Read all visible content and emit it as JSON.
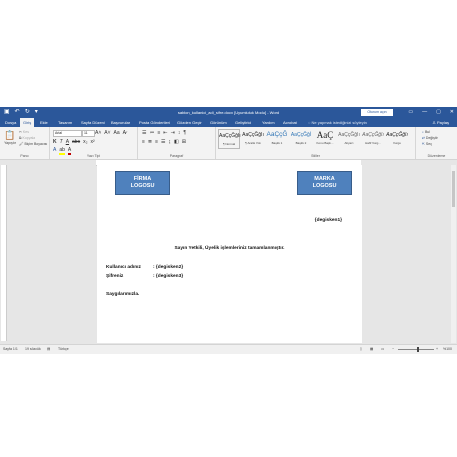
{
  "window": {
    "title": "sablon_kullanici_adi_sifre.docx [Uyumluluk Modu] - Word",
    "signin_label": "Oturum açın",
    "controls": [
      "—",
      "▢",
      "✕"
    ]
  },
  "tabs": [
    "Dosya",
    "Giriş",
    "Ekle",
    "Tasarım",
    "Sayfa Düzeni",
    "Başvurular",
    "Posta Gönderileri",
    "Gözden Geçir",
    "Görünüm",
    "Geliştirici",
    "Yardım",
    "Acrobat"
  ],
  "active_tab": "Giriş",
  "tell_me_placeholder": "Ne yapmak istediğinizi söyleyin",
  "share_label": "Paylaş",
  "ribbon": {
    "clipboard": {
      "paste_label": "Yapıştır",
      "cut_label": "Kes",
      "copy_label": "Kopyala",
      "format_painter_label": "Biçim Boyacısı",
      "group_label": "Pano"
    },
    "font": {
      "font_name": "Arial",
      "font_size": "11",
      "group_label": "Yazı Tipi"
    },
    "paragraph": {
      "group_label": "Paragraf"
    },
    "styles": {
      "group_label": "Stiller",
      "items": [
        {
          "sample": "AaÇçĞğIı",
          "name": "¶ Normal"
        },
        {
          "sample": "AaÇçĞğIı",
          "name": "¶ Aralık Yok"
        },
        {
          "sample": "AaÇçĞ",
          "name": "Başlık 1"
        },
        {
          "sample": "AaÇçĞğİ",
          "name": "Başlık 2"
        },
        {
          "sample": "AaÇ",
          "name": "Konu Başlı..."
        },
        {
          "sample": "AaÇçĞğIı",
          "name": "Altyazı"
        },
        {
          "sample": "AaÇçĞğIı",
          "name": "Hafif Vurg..."
        },
        {
          "sample": "AaÇçĞğIı",
          "name": "Vurgu"
        }
      ]
    },
    "editing": {
      "find_label": "Bul",
      "replace_label": "Değiştir",
      "select_label": "Seç",
      "group_label": "Düzenleme"
    }
  },
  "document": {
    "logo_left": [
      "FİRMA",
      "LOGOSU"
    ],
    "logo_right": [
      "MARKA",
      "LOGOSU"
    ],
    "variable1": "{degisken1}",
    "greeting": "Sayın Yetkili, Üyelik işlemleriniz tamamlanmıştır.",
    "username_label": "Kullanıcı adınız",
    "username_value": ": {degisken2}",
    "password_label": "Şifreniz",
    "password_value": ": {degisken3}",
    "closing": "Saygılarımızla."
  },
  "status": {
    "page": "Sayfa 1/1",
    "words": "19 sözcük",
    "language": "Türkçe",
    "zoom": "%100"
  },
  "colors": {
    "title_bar": "#2b579a",
    "logo_fill": "#4f81bd"
  }
}
